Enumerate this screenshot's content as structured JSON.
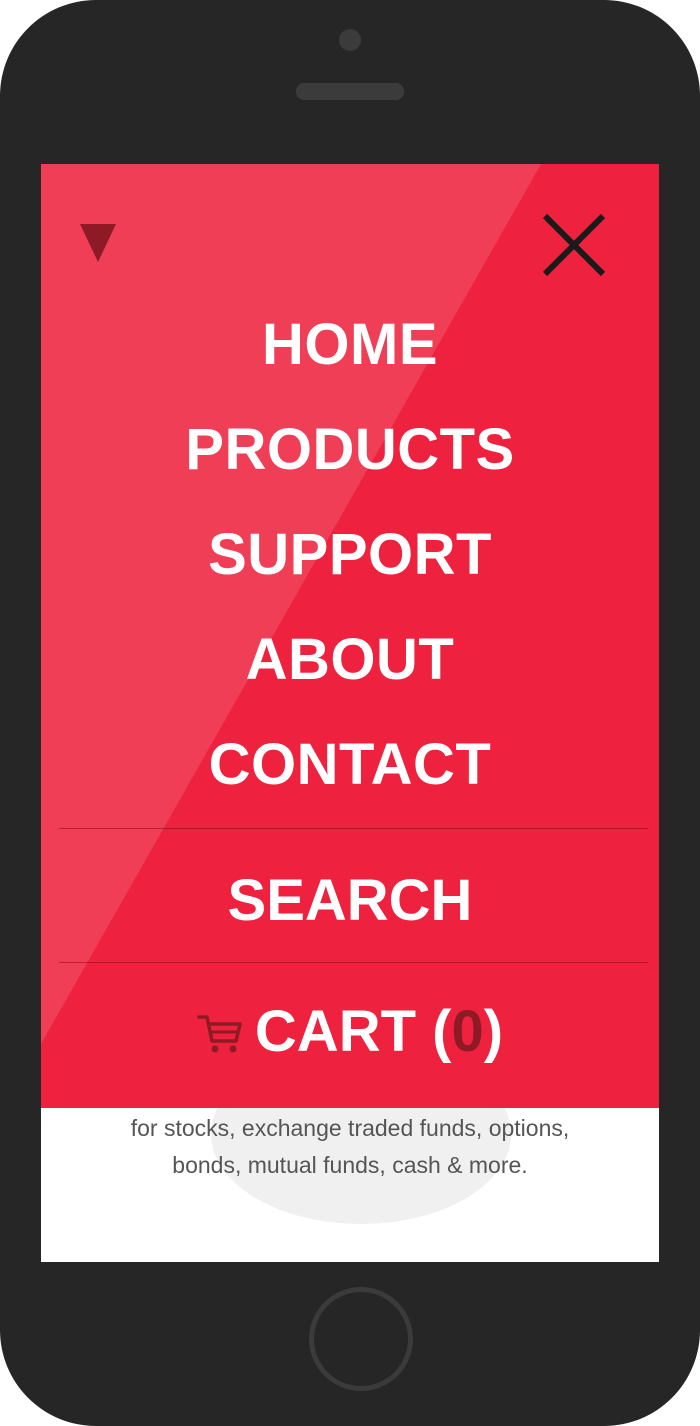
{
  "colors": {
    "menu_background": "#ee223e",
    "accent_dark": "#8e1a26",
    "phone_body": "#262626",
    "text_white": "#ffffff"
  },
  "icons": {
    "dropdown": "triangle-down-icon",
    "close": "close-icon",
    "cart": "shopping-cart-icon"
  },
  "menu": {
    "items": [
      {
        "label": "HOME"
      },
      {
        "label": "PRODUCTS"
      },
      {
        "label": "SUPPORT"
      },
      {
        "label": "ABOUT"
      },
      {
        "label": "CONTACT"
      }
    ],
    "search_label": "SEARCH",
    "cart": {
      "label": "CART",
      "open_paren": "(",
      "count": "0",
      "close_paren": ")"
    }
  },
  "page": {
    "body_line1": "for stocks, exchange traded funds, options,",
    "body_line2": "bonds, mutual funds, cash & more."
  }
}
